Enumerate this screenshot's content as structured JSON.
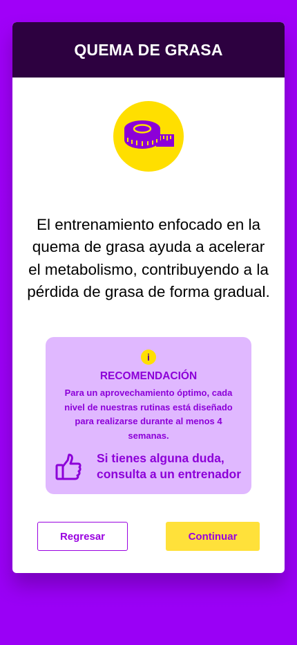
{
  "header": {
    "title": "QUEMA DE GRASA"
  },
  "main": {
    "icon": "measuring-tape-icon",
    "description": "El entrenamiento enfocado en la quema de grasa ayuda a acelerar el metabolismo, contribuyendo a la pérdida de grasa de forma gradual."
  },
  "recommendation": {
    "info_glyph": "i",
    "title": "RECOMENDACIÓN",
    "text": "Para un aprovechamiento óptimo, cada nivel de nuestras rutinas está diseñado para realizarse durante al menos 4 semanas.",
    "advice": "Si tienes alguna duda, consulta a un entrenador",
    "advice_icon": "thumbs-up-icon"
  },
  "buttons": {
    "back_label": "Regresar",
    "next_label": "Continuar"
  },
  "colors": {
    "background": "#a000f8",
    "header": "#2d0140",
    "accent_yellow": "#ffdf00",
    "accent_purple": "#8c00d8",
    "recommendation_bg": "#e0b8ff"
  }
}
